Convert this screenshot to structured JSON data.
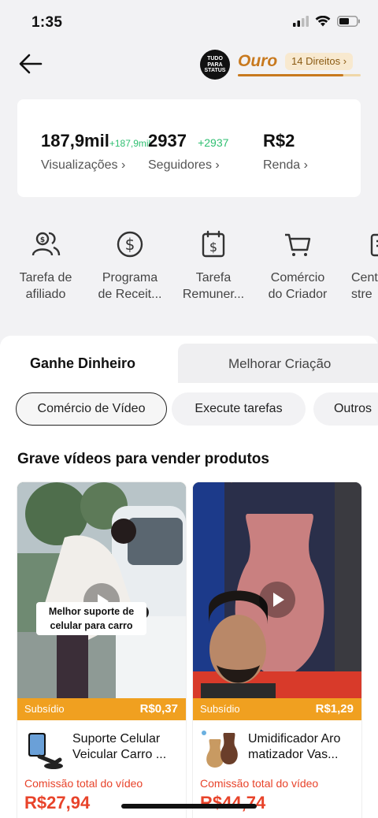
{
  "status_bar": {
    "time": "1:35"
  },
  "header": {
    "avatar_text": "TUDO PARA STATUS",
    "tier": "Ouro",
    "rights": "14 Direitos",
    "tier_progress": 0.86
  },
  "stats": [
    {
      "value": "187,9mil",
      "delta": "+187,9mil",
      "label": "Visualizações"
    },
    {
      "value": "2937",
      "delta": "+2937",
      "label": "Seguidores"
    },
    {
      "value": "R$2",
      "delta": "",
      "label": "Renda"
    }
  ],
  "tools": [
    {
      "icon": "affiliate-icon",
      "line1": "Tarefa de",
      "line2": "afiliado"
    },
    {
      "icon": "dollar-circle-icon",
      "line1": "Programa",
      "line2": "de Receit..."
    },
    {
      "icon": "calendar-dollar-icon",
      "line1": "Tarefa",
      "line2": "Remuner..."
    },
    {
      "icon": "cart-icon",
      "line1": "Comércio",
      "line2": "do Criador"
    },
    {
      "icon": "center-icon",
      "line1": "Cent",
      "line2": "stre"
    }
  ],
  "tabs": {
    "active": "Ganhe Dinheiro",
    "other": "Melhorar Criação"
  },
  "chips": [
    "Comércio de Vídeo",
    "Execute tarefas",
    "Outros"
  ],
  "section_title": "Grave vídeos para vender produtos",
  "products": [
    {
      "caption": "Melhor suporte de celular para carro",
      "subsidy_label": "Subsídio",
      "subsidy_value": "R$0,37",
      "name": "Suporte Celular Veicular Carro ...",
      "commission_label": "Comissão total do vídeo",
      "commission_value": "R$27,94"
    },
    {
      "caption": "",
      "subsidy_label": "Subsídio",
      "subsidy_value": "R$1,29",
      "name": "Umidificador Aro matizador Vas...",
      "commission_label": "Comissão total do vídeo",
      "commission_value": "R$44,74"
    }
  ],
  "colors": {
    "accent": "#c8791e",
    "subsidy": "#f0a020",
    "commission": "#e8432a",
    "positive": "#2fbf71"
  }
}
